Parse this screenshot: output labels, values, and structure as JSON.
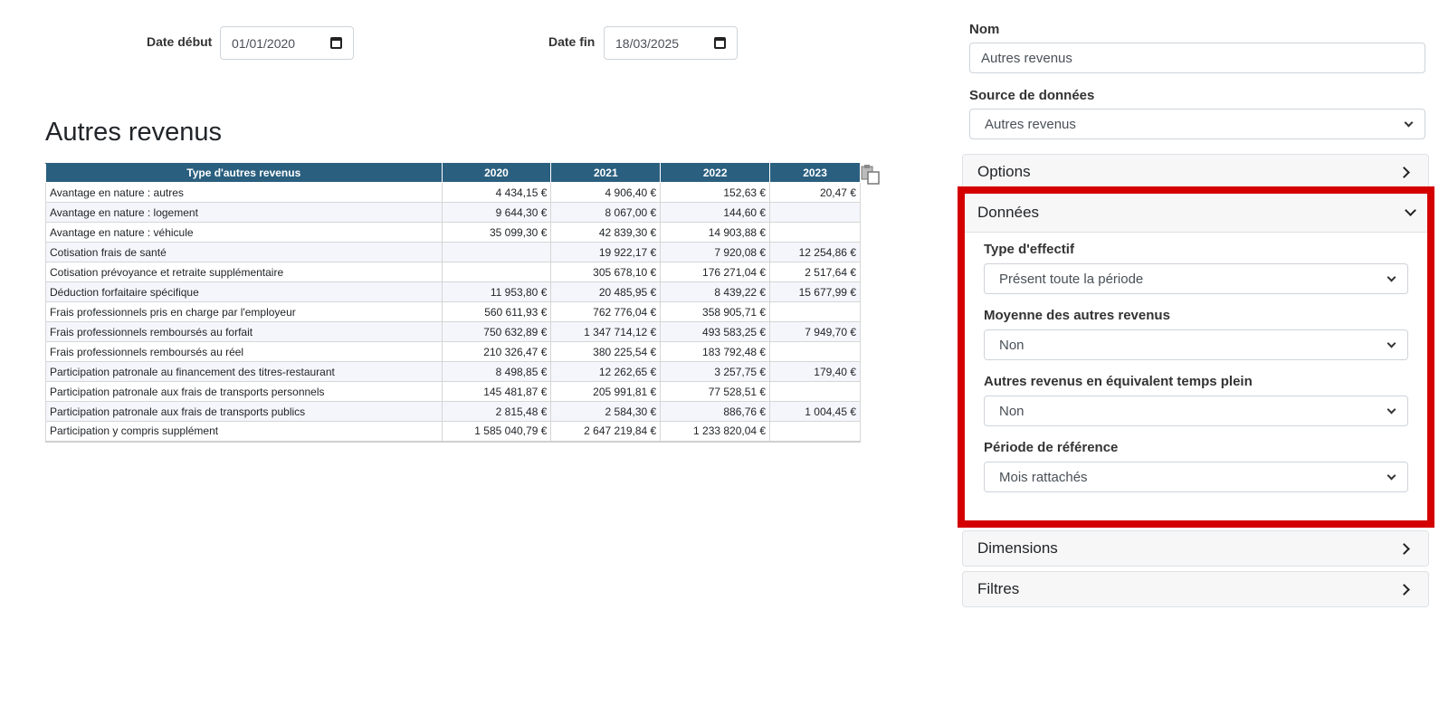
{
  "filters": {
    "date_debut_label": "Date début",
    "date_debut_value": "01/01/2020",
    "date_fin_label": "Date fin",
    "date_fin_value": "18/03/2025"
  },
  "report": {
    "title": "Autres revenus",
    "copy_icon": "copy-icon",
    "columns": [
      "Type d'autres revenus",
      "2020",
      "2021",
      "2022",
      "2023"
    ],
    "rows": [
      [
        "Avantage en nature : autres",
        "4 434,15 €",
        "4 906,40 €",
        "152,63 €",
        "20,47 €"
      ],
      [
        "Avantage en nature : logement",
        "9 644,30 €",
        "8 067,00 €",
        "144,60 €",
        ""
      ],
      [
        "Avantage en nature : véhicule",
        "35 099,30 €",
        "42 839,30 €",
        "14 903,88 €",
        ""
      ],
      [
        "Cotisation frais de santé",
        "",
        "19 922,17 €",
        "7 920,08 €",
        "12 254,86 €"
      ],
      [
        "Cotisation prévoyance et retraite supplémentaire",
        "",
        "305 678,10 €",
        "176 271,04 €",
        "2 517,64 €"
      ],
      [
        "Déduction forfaitaire spécifique",
        "11 953,80 €",
        "20 485,95 €",
        "8 439,22 €",
        "15 677,99 €"
      ],
      [
        "Frais professionnels pris en charge par l'employeur",
        "560 611,93 €",
        "762 776,04 €",
        "358 905,71 €",
        ""
      ],
      [
        "Frais professionnels remboursés au forfait",
        "750 632,89 €",
        "1 347 714,12 €",
        "493 583,25 €",
        "7 949,70 €"
      ],
      [
        "Frais professionnels remboursés au réel",
        "210 326,47 €",
        "380 225,54 €",
        "183 792,48 €",
        ""
      ],
      [
        "Participation patronale au financement des titres-restaurant",
        "8 498,85 €",
        "12 262,65 €",
        "3 257,75 €",
        "179,40 €"
      ],
      [
        "Participation patronale aux frais de transports personnels",
        "145 481,87 €",
        "205 991,81 €",
        "77 528,51 €",
        ""
      ],
      [
        "Participation patronale aux frais de transports publics",
        "2 815,48 €",
        "2 584,30 €",
        "886,76 €",
        "1 004,45 €"
      ],
      [
        "Participation y compris supplément",
        "1 585 040,79 €",
        "2 647 219,84 €",
        "1 233 820,04 €",
        ""
      ]
    ]
  },
  "panel": {
    "nom_label": "Nom",
    "nom_value": "Autres revenus",
    "source_label": "Source de données",
    "source_value": "Autres revenus",
    "sections": {
      "options": "Options",
      "donnees": "Données",
      "dimensions": "Dimensions",
      "filtres": "Filtres"
    },
    "donnees": {
      "type_effectif_label": "Type d'effectif",
      "type_effectif_value": "Présent toute la période",
      "moyenne_label": "Moyenne des autres revenus",
      "moyenne_value": "Non",
      "etp_label": "Autres revenus en équivalent temps plein",
      "etp_value": "Non",
      "periode_label": "Période de référence",
      "periode_value": "Mois rattachés"
    },
    "highlight_color": "#d40000"
  }
}
